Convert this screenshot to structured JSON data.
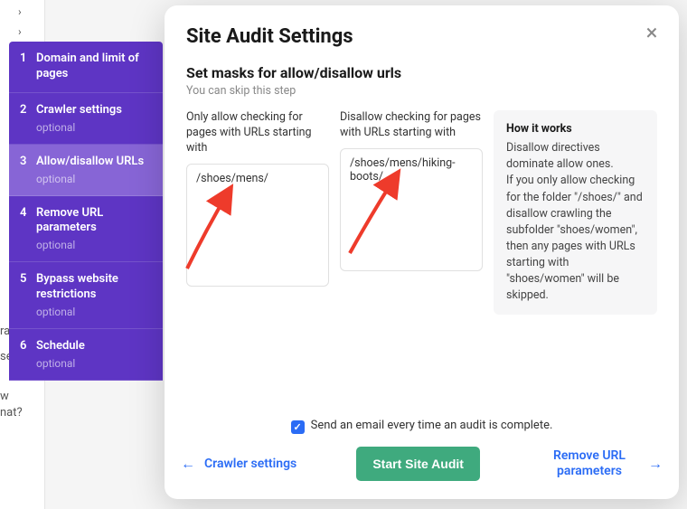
{
  "sidebar": {
    "items": [
      {
        "num": "1",
        "label": "Domain and limit of pages",
        "optional": ""
      },
      {
        "num": "2",
        "label": "Crawler settings",
        "optional": "optional"
      },
      {
        "num": "3",
        "label": "Allow/disallow URLs",
        "optional": "optional"
      },
      {
        "num": "4",
        "label": "Remove URL parameters",
        "optional": "optional"
      },
      {
        "num": "5",
        "label": "Bypass website restrictions",
        "optional": "optional"
      },
      {
        "num": "6",
        "label": "Schedule",
        "optional": "optional"
      }
    ]
  },
  "modal": {
    "title": "Site Audit Settings",
    "subtitle": "Set masks for allow/disallow urls",
    "skip": "You can skip this step",
    "allow_label": "Only allow checking for pages with URLs starting with",
    "allow_value": "/shoes/mens/",
    "disallow_label": "Disallow checking for pages with URLs starting with",
    "disallow_value": "/shoes/mens/hiking-boots/",
    "howit_title": "How it works",
    "howit_body": "Disallow directives dominate allow ones.\nIf you only allow checking for the folder \"/shoes/\" and disallow crawling the subfolder \"shoes/women\", then any pages with URLs starting with \"shoes/women\" will be skipped.",
    "email_label": "Send an email every time an audit is complete.",
    "prev_label": "Crawler settings",
    "start_label": "Start Site Audit",
    "next_label": "Remove URL parameters"
  },
  "backdrop": {
    "t1": "ram",
    "t2": "se or",
    "t3": "w\nnat?"
  }
}
